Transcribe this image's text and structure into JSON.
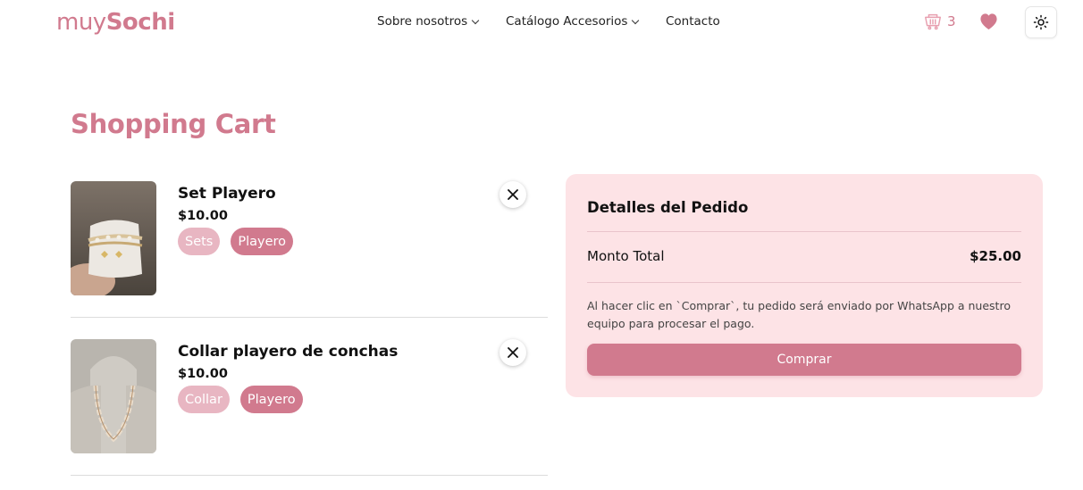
{
  "header": {
    "logo_light": "muy",
    "logo_bold": "Sochi",
    "nav": [
      {
        "label": "Sobre nosotros"
      },
      {
        "label": "Catálogo Accesorios"
      },
      {
        "label": "Contacto"
      }
    ],
    "cart_count": "3"
  },
  "page": {
    "title": "Shopping Cart"
  },
  "cart": {
    "items": [
      {
        "name": "Set Playero",
        "price": "$10.00",
        "tags": [
          "Sets",
          "Playero"
        ]
      },
      {
        "name": "Collar playero de conchas",
        "price": "$10.00",
        "tags": [
          "Collar",
          "Playero"
        ]
      }
    ]
  },
  "summary": {
    "title": "Detalles del Pedido",
    "total_label": "Monto Total",
    "total_value": "$25.00",
    "note": "Al hacer clic en `Comprar`, tu pedido será enviado por WhatsApp a nuestro equipo para procesar el pago.",
    "buy_label": "Comprar"
  },
  "colors": {
    "brand": "#d17a8e",
    "tag_light": "#e8b6c2",
    "summary_bg": "#fde3e6"
  }
}
